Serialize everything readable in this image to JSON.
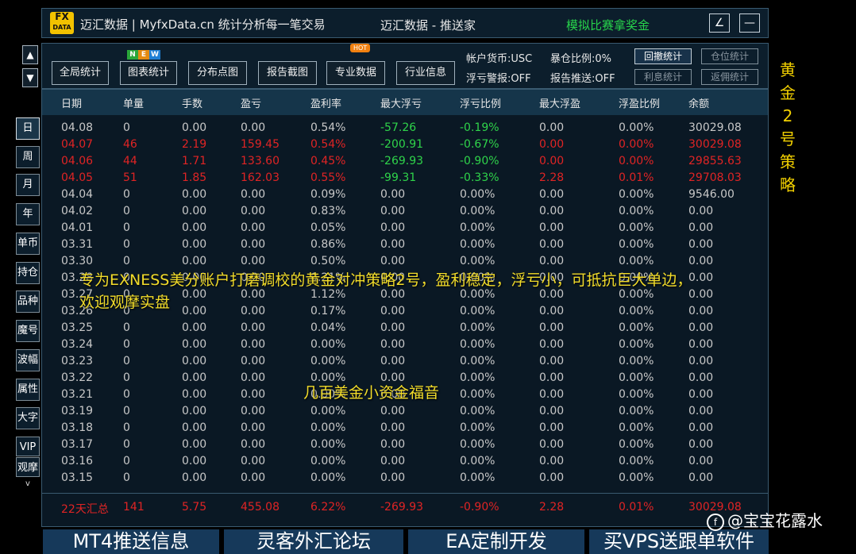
{
  "title": {
    "logo_top": "FX",
    "logo_bottom": "DATA",
    "left": "迈汇数据 | MyfxData.cn  统计分析每一笔交易",
    "mid": "迈汇数据 - 推送家",
    "right": "模拟比赛拿奖金",
    "btn_edit": "∠",
    "btn_min": "—"
  },
  "nav_arrows": {
    "up": "▲",
    "down": "▼"
  },
  "toolbar": {
    "buttons": [
      "全局统计",
      "图表统计",
      "分布点图",
      "报告截图",
      "专业数据",
      "行业信息"
    ],
    "new_badge": [
      "N",
      "E",
      "W"
    ],
    "hot_badge": "HOT",
    "account_currency": "帐户货币:USC",
    "exposure_ratio": "暴仓比例:0%",
    "float_alert": "浮亏警报:OFF",
    "report_push": "报告推送:OFF",
    "side_buttons": [
      "回撤统计",
      "仓位统计",
      "利息统计",
      "返佣统计"
    ]
  },
  "table": {
    "headers": [
      "日期",
      "单量",
      "手数",
      "盈亏",
      "盈利率",
      "最大浮亏",
      "浮亏比例",
      "最大浮盈",
      "浮盈比例",
      "余额"
    ],
    "rows": [
      {
        "c": [
          "04.08",
          "0",
          "0.00",
          "0.00",
          "0.54%",
          "-57.26",
          "-0.19%",
          "0.00",
          "0.00%",
          "30029.08"
        ],
        "s": "gray"
      },
      {
        "c": [
          "04.07",
          "46",
          "2.19",
          "159.45",
          "0.54%",
          "-200.91",
          "-0.67%",
          "0.00",
          "0.00%",
          "30029.08"
        ],
        "s": "red"
      },
      {
        "c": [
          "04.06",
          "44",
          "1.71",
          "133.60",
          "0.45%",
          "-269.93",
          "-0.90%",
          "0.00",
          "0.00%",
          "29855.63"
        ],
        "s": "red"
      },
      {
        "c": [
          "04.05",
          "51",
          "1.85",
          "162.03",
          "0.55%",
          "-99.31",
          "-0.33%",
          "2.28",
          "0.01%",
          "29708.03"
        ],
        "s": "red"
      },
      {
        "c": [
          "04.04",
          "0",
          "0.00",
          "0.00",
          "0.09%",
          "0.00",
          "0.00%",
          "0.00",
          "0.00%",
          "9546.00"
        ],
        "s": "gray"
      },
      {
        "c": [
          "04.02",
          "0",
          "0.00",
          "0.00",
          "0.83%",
          "0.00",
          "0.00%",
          "0.00",
          "0.00%",
          "0.00"
        ],
        "s": "gray"
      },
      {
        "c": [
          "04.01",
          "0",
          "0.00",
          "0.00",
          "0.05%",
          "0.00",
          "0.00%",
          "0.00",
          "0.00%",
          "0.00"
        ],
        "s": "gray"
      },
      {
        "c": [
          "03.31",
          "0",
          "0.00",
          "0.00",
          "0.86%",
          "0.00",
          "0.00%",
          "0.00",
          "0.00%",
          "0.00"
        ],
        "s": "gray"
      },
      {
        "c": [
          "03.30",
          "0",
          "0.00",
          "0.00",
          "0.50%",
          "0.00",
          "0.00%",
          "0.00",
          "0.00%",
          "0.00"
        ],
        "s": "gray"
      },
      {
        "c": [
          "03.28",
          "0",
          "0.00",
          "0.00",
          "0.21%",
          "0.00",
          "0.00%",
          "0.00",
          "0.00%",
          "0.00"
        ],
        "s": "gray"
      },
      {
        "c": [
          "03.27",
          "0",
          "0.00",
          "0.00",
          "1.12%",
          "0.00",
          "0.00%",
          "0.00",
          "0.00%",
          "0.00"
        ],
        "s": "gray"
      },
      {
        "c": [
          "03.26",
          "0",
          "0.00",
          "0.00",
          "0.17%",
          "0.00",
          "0.00%",
          "0.00",
          "0.00%",
          "0.00"
        ],
        "s": "gray"
      },
      {
        "c": [
          "03.25",
          "0",
          "0.00",
          "0.00",
          "0.04%",
          "0.00",
          "0.00%",
          "0.00",
          "0.00%",
          "0.00"
        ],
        "s": "gray"
      },
      {
        "c": [
          "03.24",
          "0",
          "0.00",
          "0.00",
          "0.00%",
          "0.00",
          "0.00%",
          "0.00",
          "0.00%",
          "0.00"
        ],
        "s": "gray"
      },
      {
        "c": [
          "03.23",
          "0",
          "0.00",
          "0.00",
          "0.00%",
          "0.00",
          "0.00%",
          "0.00",
          "0.00%",
          "0.00"
        ],
        "s": "gray"
      },
      {
        "c": [
          "03.22",
          "0",
          "0.00",
          "0.00",
          "0.00%",
          "0.00",
          "0.00%",
          "0.00",
          "0.00%",
          "0.00"
        ],
        "s": "gray"
      },
      {
        "c": [
          "03.21",
          "0",
          "0.00",
          "0.00",
          "0.00%",
          "0.00",
          "0.00%",
          "0.00",
          "0.00%",
          "0.00"
        ],
        "s": "gray"
      },
      {
        "c": [
          "03.19",
          "0",
          "0.00",
          "0.00",
          "0.00%",
          "0.00",
          "0.00%",
          "0.00",
          "0.00%",
          "0.00"
        ],
        "s": "gray"
      },
      {
        "c": [
          "03.18",
          "0",
          "0.00",
          "0.00",
          "0.00%",
          "0.00",
          "0.00%",
          "0.00",
          "0.00%",
          "0.00"
        ],
        "s": "gray"
      },
      {
        "c": [
          "03.17",
          "0",
          "0.00",
          "0.00",
          "0.00%",
          "0.00",
          "0.00%",
          "0.00",
          "0.00%",
          "0.00"
        ],
        "s": "gray"
      },
      {
        "c": [
          "03.16",
          "0",
          "0.00",
          "0.00",
          "0.00%",
          "0.00",
          "0.00%",
          "0.00",
          "0.00%",
          "0.00"
        ],
        "s": "gray"
      },
      {
        "c": [
          "03.15",
          "0",
          "0.00",
          "0.00",
          "0.00%",
          "0.00",
          "0.00%",
          "0.00",
          "0.00%",
          "0.00"
        ],
        "s": "gray"
      }
    ],
    "summary": [
      "22天汇总",
      "141",
      "5.75",
      "455.08",
      "6.22%",
      "-269.93",
      "-0.90%",
      "2.28",
      "0.01%",
      "30029.08"
    ]
  },
  "side_nav": [
    "日",
    "周",
    "月",
    "年",
    "单币",
    "持仓",
    "品种",
    "魔号",
    "波幅",
    "属性",
    "大字",
    "VIP",
    "观摩"
  ],
  "side_chevron": "v",
  "vertical_text": [
    "黄",
    "金",
    "2",
    "号",
    "策",
    "略"
  ],
  "captions": {
    "line1": "专为EXNESS美分账户打磨调校的黄金对冲策略2号，盈利稳定，浮亏小，可抵抗巨大单边，",
    "line2": "欢迎观摩实盘",
    "line3": "几百美金小资金福音"
  },
  "banners": [
    "MT4推送信息",
    "灵客外汇论坛",
    "EA定制开发",
    "买VPS送跟单软件"
  ],
  "watermark": {
    "icon": "f",
    "text": "@宝宝花露水"
  },
  "colors": {
    "green": "#2fd44a",
    "red": "#e02424",
    "gold": "#f2d000",
    "header_bg": "#15354a"
  }
}
